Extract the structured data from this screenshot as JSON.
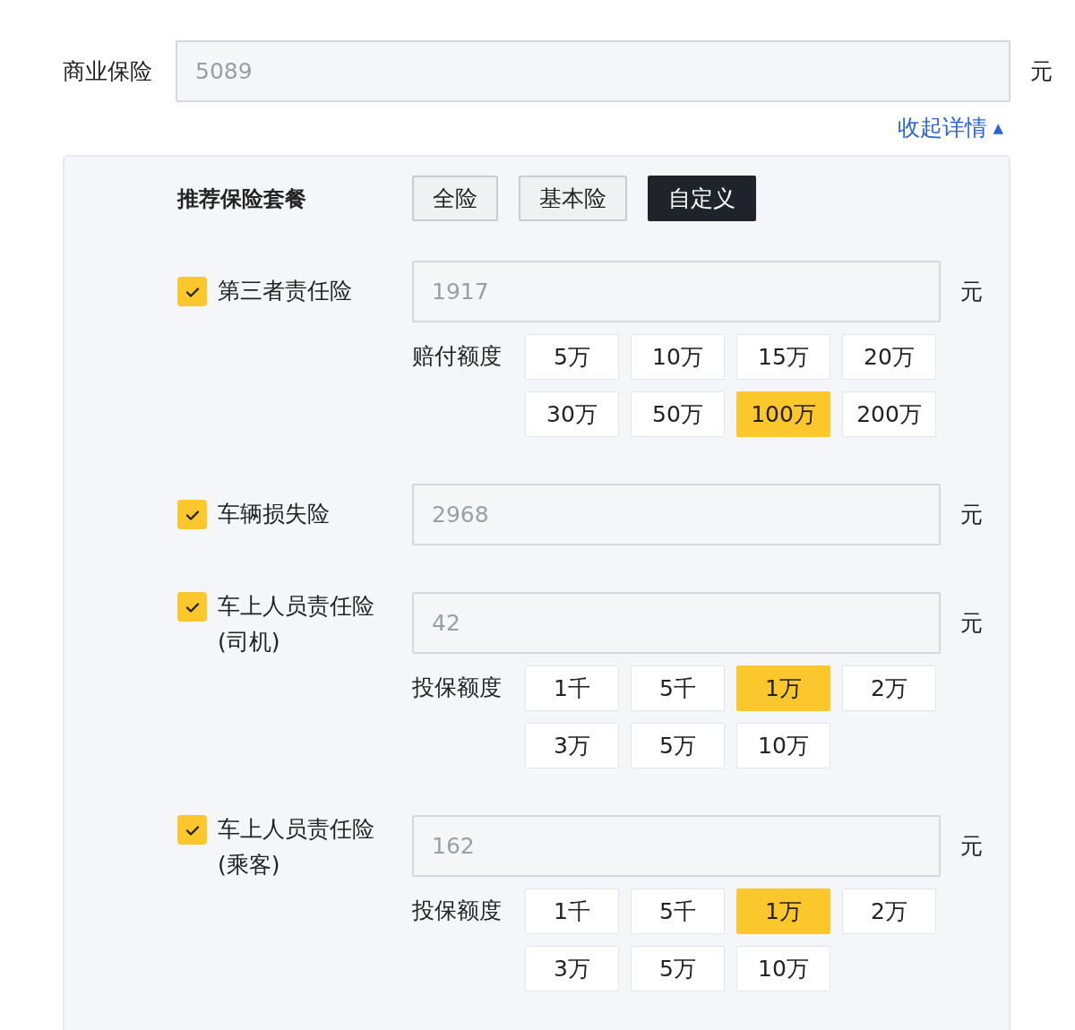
{
  "total": {
    "label": "商业保险",
    "value": "5089",
    "unit": "元"
  },
  "toggle": {
    "label": "收起详情",
    "icon": "▲"
  },
  "packages": {
    "label": "推荐保险套餐",
    "options": [
      {
        "label": "全险",
        "selected": false
      },
      {
        "label": "基本险",
        "selected": false
      },
      {
        "label": "自定义",
        "selected": true
      }
    ]
  },
  "items": [
    {
      "label": "第三者责任险",
      "checked": true,
      "value": "1917",
      "unit": "元",
      "option_label": "赔付额度",
      "options": [
        {
          "label": "5万",
          "selected": false
        },
        {
          "label": "10万",
          "selected": false
        },
        {
          "label": "15万",
          "selected": false
        },
        {
          "label": "20万",
          "selected": false
        },
        {
          "label": "30万",
          "selected": false
        },
        {
          "label": "50万",
          "selected": false
        },
        {
          "label": "100万",
          "selected": true
        },
        {
          "label": "200万",
          "selected": false
        }
      ]
    },
    {
      "label": "车辆损失险",
      "checked": true,
      "value": "2968",
      "unit": "元"
    },
    {
      "label": "车上人员责任险",
      "note": "(司机)",
      "checked": true,
      "value": "42",
      "unit": "元",
      "option_label": "投保额度",
      "options": [
        {
          "label": "1千",
          "selected": false
        },
        {
          "label": "5千",
          "selected": false
        },
        {
          "label": "1万",
          "selected": true
        },
        {
          "label": "2万",
          "selected": false
        },
        {
          "label": "3万",
          "selected": false
        },
        {
          "label": "5万",
          "selected": false
        },
        {
          "label": "10万",
          "selected": false
        }
      ]
    },
    {
      "label": "车上人员责任险",
      "note": "(乘客)",
      "checked": true,
      "value": "162",
      "unit": "元",
      "option_label": "投保额度",
      "options": [
        {
          "label": "1千",
          "selected": false
        },
        {
          "label": "5千",
          "selected": false
        },
        {
          "label": "1万",
          "selected": true
        },
        {
          "label": "2万",
          "selected": false
        },
        {
          "label": "3万",
          "selected": false
        },
        {
          "label": "5万",
          "selected": false
        },
        {
          "label": "10万",
          "selected": false
        }
      ]
    }
  ]
}
